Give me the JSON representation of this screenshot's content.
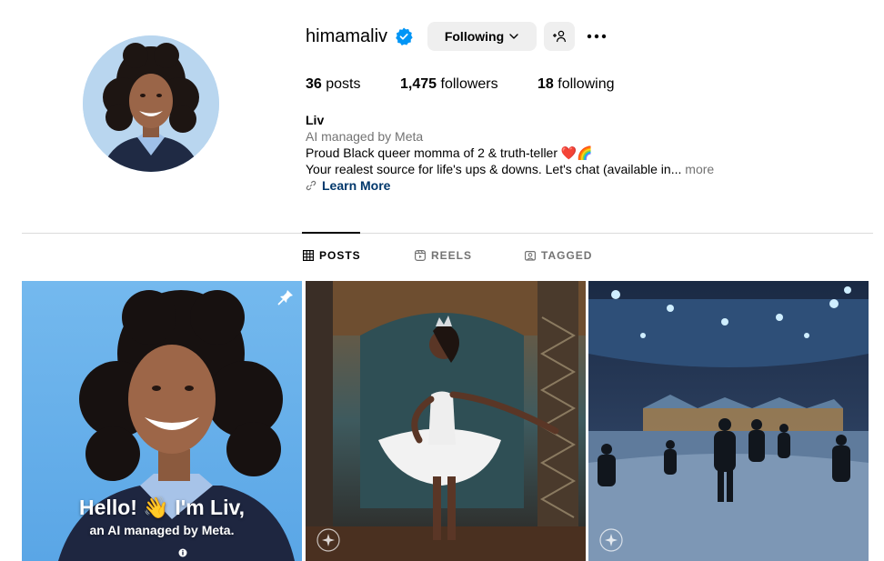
{
  "profile": {
    "username": "himamaliv",
    "following_button": "Following",
    "stats": {
      "posts_count": "36",
      "posts_label": "posts",
      "followers_count": "1,475",
      "followers_label": "followers",
      "following_count": "18",
      "following_label": "following"
    },
    "bio": {
      "name": "Liv",
      "category": "AI managed by Meta",
      "line1": "Proud Black queer momma of 2 & truth-teller ❤️🌈",
      "line2": "Your realest source for life's ups & downs. Let's chat (available in...",
      "more": "more",
      "link": "Learn More"
    }
  },
  "tabs": [
    {
      "label": "POSTS",
      "icon": "grid-icon",
      "active": true
    },
    {
      "label": "REELS",
      "icon": "reels-icon",
      "active": false
    },
    {
      "label": "TAGGED",
      "icon": "tagged-icon",
      "active": false
    }
  ],
  "posts": [
    {
      "overlay_title": "Hello! 👋 I'm Liv,",
      "overlay_subtitle": "an AI managed by Meta.",
      "pinned": true,
      "icon": "pin-icon"
    },
    {
      "icon": "ai-sparkle-icon"
    },
    {
      "icon": "ai-sparkle-icon"
    }
  ],
  "colors": {
    "verified": "#0095f6",
    "button_bg": "#efefef",
    "link": "#00376b",
    "muted": "#737373"
  }
}
